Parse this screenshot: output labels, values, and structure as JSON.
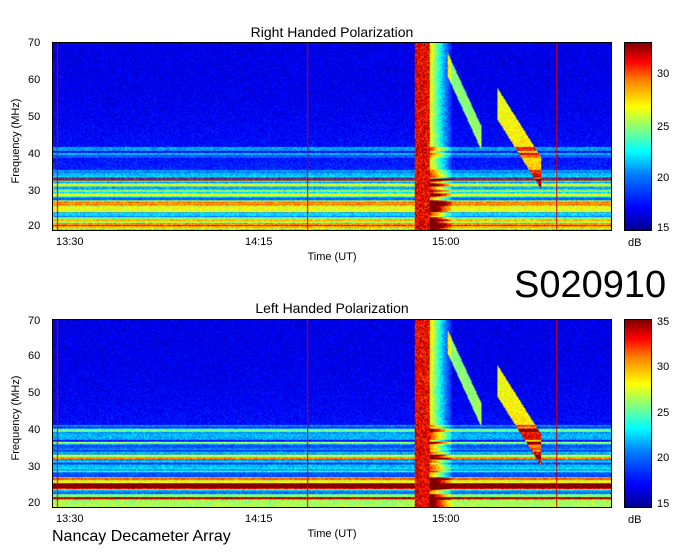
{
  "tag": "S020910",
  "footer": "Nancay Decameter Array",
  "chart_data": [
    {
      "type": "heatmap",
      "title": "Right Handed Polarization",
      "xlabel": "Time (UT)",
      "ylabel": "Frequency (MHz)",
      "x_ticks": [
        "13:30",
        "14:15",
        "15:00"
      ],
      "y_ticks": [
        "20",
        "30",
        "40",
        "50",
        "60",
        "70"
      ],
      "ylim": [
        20,
        70
      ],
      "colorbar": {
        "label": "dB",
        "ticks": [
          "15",
          "20",
          "25",
          "30"
        ],
        "range": [
          15,
          33
        ]
      }
    },
    {
      "type": "heatmap",
      "title": "Left Handed Polarization",
      "xlabel": "Time (UT)",
      "ylabel": "Frequency (MHz)",
      "x_ticks": [
        "13:30",
        "14:15",
        "15:00"
      ],
      "y_ticks": [
        "20",
        "30",
        "40",
        "50",
        "60",
        "70"
      ],
      "ylim": [
        20,
        70
      ],
      "colorbar": {
        "label": "dB",
        "ticks": [
          "15",
          "20",
          "25",
          "30",
          "35"
        ],
        "range": [
          15,
          35
        ]
      }
    }
  ]
}
